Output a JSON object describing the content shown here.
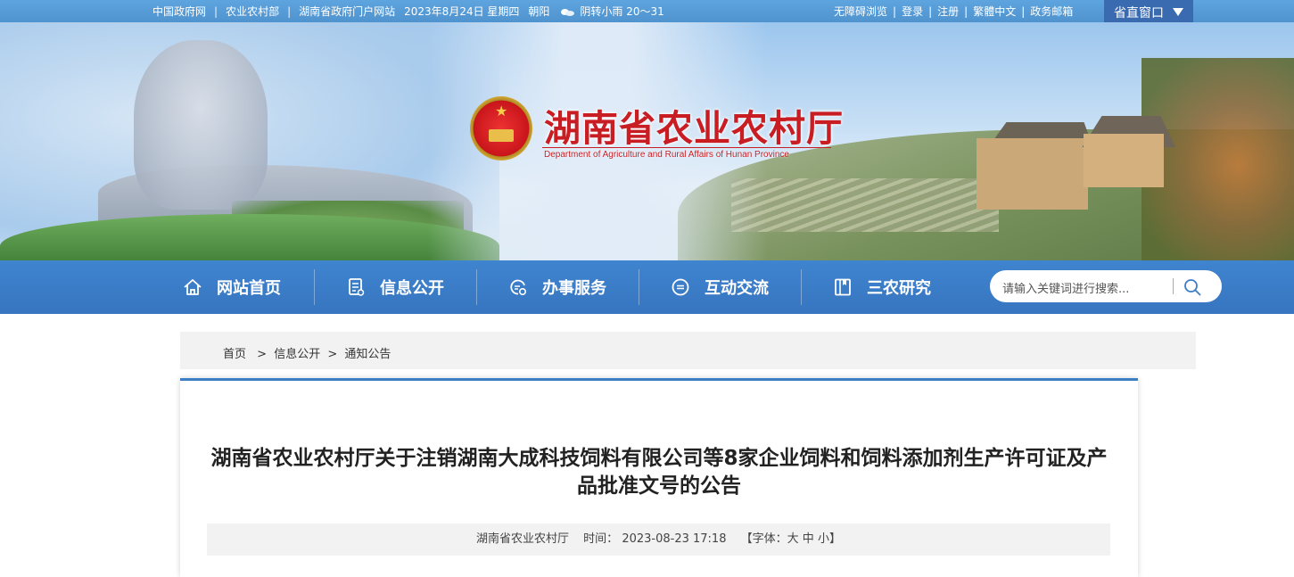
{
  "topbar": {
    "links_left": [
      "中国政府网",
      "农业农村部",
      "湖南省政府门户网站"
    ],
    "date": "2023年8月24日 星期四",
    "city": "朝阳",
    "weather": "阴转小雨 20～31",
    "links_right": [
      "无障碍浏览",
      "登录",
      "注册",
      "繁體中文",
      "政务邮箱"
    ],
    "province_window": "省直窗口"
  },
  "header": {
    "title": "湖南省农业农村厅",
    "subtitle": "Department of Agriculture and Rural Affairs of Hunan Province"
  },
  "nav": {
    "items": [
      {
        "label": "网站首页",
        "icon": "home-icon"
      },
      {
        "label": "信息公开",
        "icon": "document-icon"
      },
      {
        "label": "办事服务",
        "icon": "service-icon"
      },
      {
        "label": "互动交流",
        "icon": "chat-icon"
      },
      {
        "label": "三农研究",
        "icon": "book-icon"
      }
    ],
    "search_placeholder": "请输入关键词进行搜索..."
  },
  "breadcrumb": [
    "首页",
    "信息公开",
    "通知公告"
  ],
  "article": {
    "title": "湖南省农业农村厅关于注销湖南大成科技饲料有限公司等8家企业饲料和饲料添加剂生产许可证及产品批准文号的公告",
    "source": "湖南省农业农村厅",
    "time_label": "时间：",
    "time": "2023-08-23 17:18",
    "font_label": "【字体：",
    "font_large": "大",
    "font_medium": "中",
    "font_small": "小",
    "font_close": "】"
  }
}
